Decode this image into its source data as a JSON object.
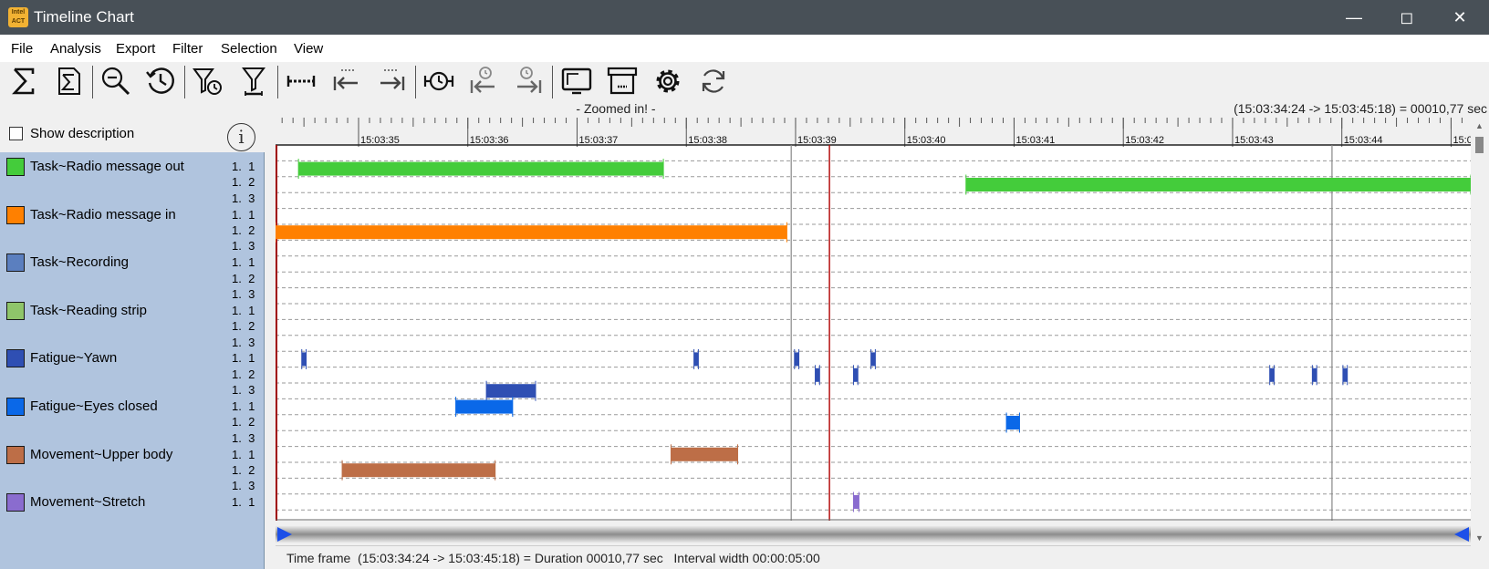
{
  "window": {
    "title": "Timeline Chart",
    "app_icon_text": "Intel\nACT"
  },
  "menu": [
    "File",
    "Analysis",
    "Export",
    "Filter",
    "Selection",
    "View"
  ],
  "toolbar": {
    "buttons": [
      {
        "icon": "sum-icon"
      },
      {
        "icon": "sum-document-icon"
      },
      {
        "icon": "zoom-out-icon"
      },
      {
        "icon": "history-clock-icon"
      },
      {
        "icon": "filter-clock-icon"
      },
      {
        "icon": "filter-range-icon"
      },
      {
        "icon": "interval-icon"
      },
      {
        "icon": "interval-back-icon"
      },
      {
        "icon": "interval-forward-icon"
      },
      {
        "icon": "clock-interval-icon"
      },
      {
        "icon": "clock-back-icon"
      },
      {
        "icon": "clock-forward-icon"
      },
      {
        "icon": "screen-icon"
      },
      {
        "icon": "archive-icon"
      },
      {
        "icon": "gear-icon"
      },
      {
        "icon": "refresh-icon"
      }
    ]
  },
  "zoom_status": "- Zoomed in! -",
  "range_readout": "(15:03:34:24 -> 15:03:45:18) = 00010,77 sec",
  "show_description": {
    "label": "Show description",
    "checked": false
  },
  "info_icon_text": "i",
  "categories": [
    {
      "label": "Task~Radio message out",
      "color": "#44cc3b",
      "subs": [
        "1.  1",
        "1.  2",
        "1.  3"
      ]
    },
    {
      "label": "Task~Radio message in",
      "color": "#ff8000",
      "subs": [
        "1.  1",
        "1.  2",
        "1.  3"
      ]
    },
    {
      "label": "Task~Recording",
      "color": "#5b7fbf",
      "subs": [
        "1.  1",
        "1.  2",
        "1.  3"
      ]
    },
    {
      "label": "Task~Reading strip",
      "color": "#8fc56a",
      "subs": [
        "1.  1",
        "1.  2",
        "1.  3"
      ]
    },
    {
      "label": "Fatigue~Yawn",
      "color": "#2f4fb3",
      "subs": [
        "1.  1",
        "1.  2",
        "1.  3"
      ]
    },
    {
      "label": "Fatigue~Eyes closed",
      "color": "#0a68e8",
      "subs": [
        "1.  1",
        "1.  2",
        "1.  3"
      ]
    },
    {
      "label": "Movement~Upper body",
      "color": "#bd6e47",
      "subs": [
        "1.  1",
        "1.  2",
        "1.  3"
      ]
    },
    {
      "label": "Movement~Stretch",
      "color": "#8a6ccf",
      "subs": [
        "1.  1"
      ]
    }
  ],
  "chart_data": {
    "type": "timeline",
    "x_start": 34.24,
    "x_end": 45.18,
    "tick_labels": [
      "15:03:35",
      "15:03:36",
      "15:03:37",
      "15:03:38",
      "15:03:39",
      "15:03:40",
      "15:03:41",
      "15:03:42",
      "15:03:43",
      "15:03:44",
      "15:03:45"
    ],
    "tick_values": [
      35,
      36,
      37,
      38,
      39,
      40,
      41,
      42,
      43,
      44,
      45
    ],
    "cursor_line": 39.31,
    "interval_lines": [
      38.96,
      43.91
    ],
    "bars": [
      {
        "row": 1,
        "start": 34.45,
        "end": 37.79,
        "color": "#44cc3b"
      },
      {
        "row": 2,
        "start": 40.56,
        "end": 45.18,
        "color": "#44cc3b"
      },
      {
        "row": 5,
        "start": 34.24,
        "end": 38.92,
        "color": "#ff8000"
      },
      {
        "row": 13,
        "start": 34.48,
        "end": 34.52,
        "color": "#2f4fb3"
      },
      {
        "row": 13,
        "start": 38.07,
        "end": 38.11,
        "color": "#2f4fb3"
      },
      {
        "row": 13,
        "start": 38.99,
        "end": 39.03,
        "color": "#2f4fb3"
      },
      {
        "row": 14,
        "start": 39.18,
        "end": 39.22,
        "color": "#2f4fb3"
      },
      {
        "row": 14,
        "start": 39.53,
        "end": 39.57,
        "color": "#2f4fb3"
      },
      {
        "row": 13,
        "start": 39.69,
        "end": 39.73,
        "color": "#2f4fb3"
      },
      {
        "row": 14,
        "start": 43.34,
        "end": 43.38,
        "color": "#2f4fb3"
      },
      {
        "row": 14,
        "start": 43.73,
        "end": 43.77,
        "color": "#2f4fb3"
      },
      {
        "row": 14,
        "start": 44.01,
        "end": 44.05,
        "color": "#2f4fb3"
      },
      {
        "row": 15,
        "start": 36.17,
        "end": 36.62,
        "color": "#2f4fb3"
      },
      {
        "row": 16,
        "start": 35.89,
        "end": 36.41,
        "color": "#0a68e8"
      },
      {
        "row": 17,
        "start": 40.93,
        "end": 41.05,
        "color": "#0a68e8"
      },
      {
        "row": 19,
        "start": 37.86,
        "end": 38.47,
        "color": "#bd6e47"
      },
      {
        "row": 20,
        "start": 34.85,
        "end": 36.25,
        "color": "#bd6e47"
      },
      {
        "row": 22,
        "start": 39.53,
        "end": 39.58,
        "color": "#8a6ccf"
      }
    ]
  },
  "status": {
    "time_frame": "Time frame  (15:03:34:24 -> 15:03:45:18) = Duration 00010,77 sec   Interval width 00:00:05:00"
  }
}
